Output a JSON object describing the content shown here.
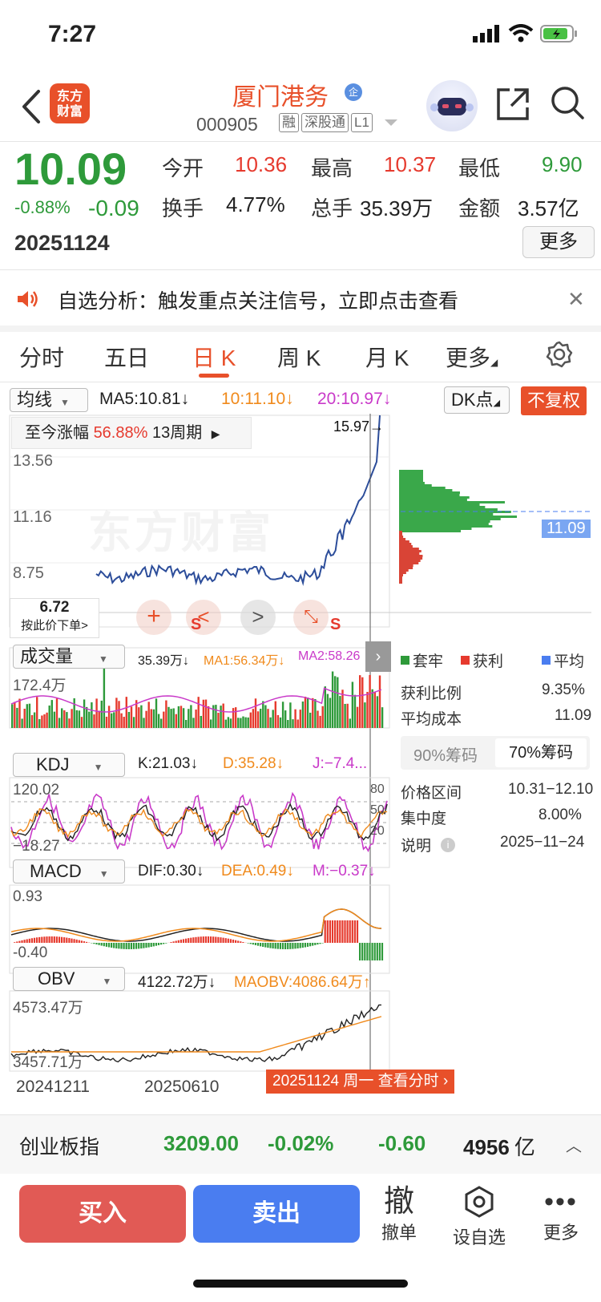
{
  "status": {
    "time": "7:27"
  },
  "header": {
    "logo_text_1": "东方",
    "logo_text_2": "财富",
    "stock_name": "厦门港务",
    "badge": "企",
    "code": "000905",
    "tags": [
      "融",
      "深股通",
      "L1"
    ]
  },
  "quote": {
    "price": "10.09",
    "pct": "-0.88%",
    "chg": "-0.09",
    "date": "20251124",
    "fields": [
      {
        "label": "今开",
        "value": "10.36",
        "color": "#e63a2e"
      },
      {
        "label": "最高",
        "value": "10.37",
        "color": "#e63a2e"
      },
      {
        "label": "最低",
        "value": "9.90",
        "color": "#2e9a3a"
      },
      {
        "label": "换手",
        "value": "4.77%",
        "color": "#222"
      },
      {
        "label": "总手",
        "value": "35.39万",
        "color": "#222"
      },
      {
        "label": "金额",
        "value": "3.57亿",
        "color": "#222"
      }
    ],
    "more": "更多"
  },
  "banner": {
    "text": "自选分析：触发重点关注信号，立即点击查看"
  },
  "tabs": [
    "分时",
    "五日",
    "日 K",
    "周 K",
    "月 K",
    "更多"
  ],
  "toolbar": {
    "ma_dropdown": "均线",
    "ma5": "MA5:10.81↓",
    "ma10": "10:11.10↓",
    "ma20": "20:10.97↓",
    "dk": "DK点",
    "nofq": "不复权"
  },
  "kline": {
    "rise_label": "至今涨幅",
    "rise_value": "56.88%",
    "rise_period": "13周期",
    "max_label": "15.97→",
    "y_labels": [
      "13.56",
      "11.16",
      "8.75"
    ],
    "left_price": "6.72",
    "left_price_hint": "按此价下单>",
    "watermark": "东方财富",
    "cost_line_label": "11.09"
  },
  "volume": {
    "name": "成交量",
    "v": "35.39万↓",
    "ma1": "MA1:56.34万↓",
    "ma2": "MA2:58.26",
    "ymax": "172.4万"
  },
  "kdj": {
    "name": "KDJ",
    "k": "K:21.03↓",
    "d": "D:35.28↓",
    "j": "J:−7.4...",
    "ymax": "120.02",
    "ymin": "−18.27",
    "levels": [
      "80",
      "50",
      "20"
    ]
  },
  "macd": {
    "name": "MACD",
    "dif": "DIF:0.30↓",
    "dea": "DEA:0.49↓",
    "m": "M:−0.37↓",
    "ymax": "0.93",
    "ymin": "-0.40"
  },
  "obv": {
    "name": "OBV",
    "v": "4122.72万↓",
    "maobv": "MAOBV:4086.64万↑",
    "ymax": "4573.47万",
    "ymin": "3457.71万"
  },
  "x_axis": {
    "d1": "20241211",
    "d2": "20250610",
    "tooltip": "20251124 周一 查看分时"
  },
  "chips": {
    "legend": [
      "套牢",
      "获利",
      "平均"
    ],
    "profit_ratio_label": "获利比例",
    "profit_ratio": "9.35%",
    "avg_cost_label": "平均成本",
    "avg_cost": "11.09",
    "tab_90": "90%筹码",
    "tab_70": "70%筹码",
    "range_label": "价格区间",
    "range": "10.31−12.10",
    "concentration_label": "集中度",
    "concentration": "8.00%",
    "note_label": "说明",
    "note_date": "2025−11−24"
  },
  "index_bar": {
    "name": "创业板指",
    "value": "3209.00",
    "pct": "-0.02%",
    "chg": "-0.60",
    "amount": "4956",
    "amount_unit": "亿"
  },
  "actions": {
    "buy": "买入",
    "sell": "卖出",
    "cancel": "撤单",
    "cancel_glyph": "撤",
    "watch": "设自选",
    "more": "更多"
  },
  "colors": {
    "up": "#e63a2e",
    "down": "#2e9a3a",
    "accent": "#e8502a",
    "sell": "#4a7df0"
  }
}
